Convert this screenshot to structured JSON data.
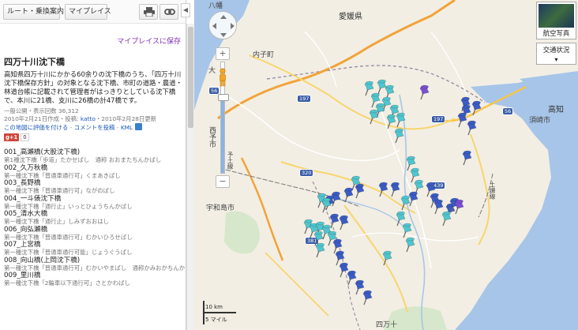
{
  "toolbar": {
    "route_label": "ルート・乗換案内",
    "myplaces_label": "マイプレイス",
    "collapse_glyph": "◀"
  },
  "panel": {
    "save_link": "マイプレイスに保存",
    "title": "四万十川沈下橋",
    "description": "高知県四万十川にかかる60余りの沈下橋のうち、「四万十川沈下橋保存方針」の対象となる沈下橋、市町の道路・農道・林道台帳に記載されて管理者がはっきりとしている沈下橋で、本川に21橋、支川に26橋の計47橋です。",
    "meta_line1": "一般公開・表示回数 36,312",
    "meta_line2_prefix": "2010年2月21日作成・投稿: ",
    "meta_author": "katto",
    "meta_line2_suffix": "・2010年2月28日更新",
    "links": {
      "rate": "この地図に評価を付ける",
      "sep1": " - ",
      "comment": "コメントを投稿",
      "sep2": " - ",
      "kml": "KML"
    },
    "share": {
      "gplus": "g+1",
      "count": "0"
    },
    "items": [
      {
        "title": "001_高瀬橋(大股沈下橋)",
        "sub": "第1種沈下橋「歩道」たかせばし　通称 おおまたちんかばし"
      },
      {
        "title": "002_久万秋橋",
        "sub": "第一種沈下橋「普通車通行可」くまあきばし"
      },
      {
        "title": "003_長野橋",
        "sub": "第一種沈下橋「普通車通行可」ながのばし"
      },
      {
        "title": "004_一斗俵沈下橋",
        "sub": "第一種沈下橋「通行止」いっとひょうちんかばし"
      },
      {
        "title": "005_清水大橋",
        "sub": "第一種沈下橋「通行止」しみずおおはし"
      },
      {
        "title": "006_向弘瀬橋",
        "sub": "第一種沈下橋「普通車通行可」むかいひろせばし"
      },
      {
        "title": "007_上宮橋",
        "sub": "第一種沈下橋「普通車通行可能」じょうぐうばし"
      },
      {
        "title": "008_向山橋(上岡沈下橋)",
        "sub": "第一種沈下橋「普通車通行可」むかいやまばし　通称かみおかちんか"
      },
      {
        "title": "009_里川橋",
        "sub": "第一種沈下橋「2輪車以下通行可」さとかわばし"
      }
    ]
  },
  "map": {
    "labels": {
      "ehime": "愛媛県",
      "kochi": "高知",
      "susaki": "須崎市",
      "uwajima": "宇和島市",
      "seiyo": "西予市",
      "uchiko": "内子町",
      "ozu": "大",
      "yodo_line": "予土線",
      "tosa_line": "土讃線",
      "shimanto": "四万十",
      "yawatahama": "八幡"
    },
    "road_badges": [
      "197",
      "56",
      "320",
      "381",
      "56",
      "197",
      "439"
    ],
    "controls": {
      "satellite_label": "航空写真",
      "traffic_label": "交通状況",
      "traffic_arrow": "▾",
      "zoom_in": "+",
      "zoom_out": "−",
      "zoom_level_fraction": 0.69
    },
    "scale": {
      "km": "10 km",
      "mi": "5 マイル"
    },
    "colors": {
      "pin_cyan": "#4fc6cf",
      "pin_blue": "#3b5cc6",
      "pin_purple": "#7a4fd2",
      "sea": "#a7c5e8",
      "land": "#f2eee4",
      "accent_link": "#1a55b5",
      "save_link": "#7b2fb5"
    }
  }
}
